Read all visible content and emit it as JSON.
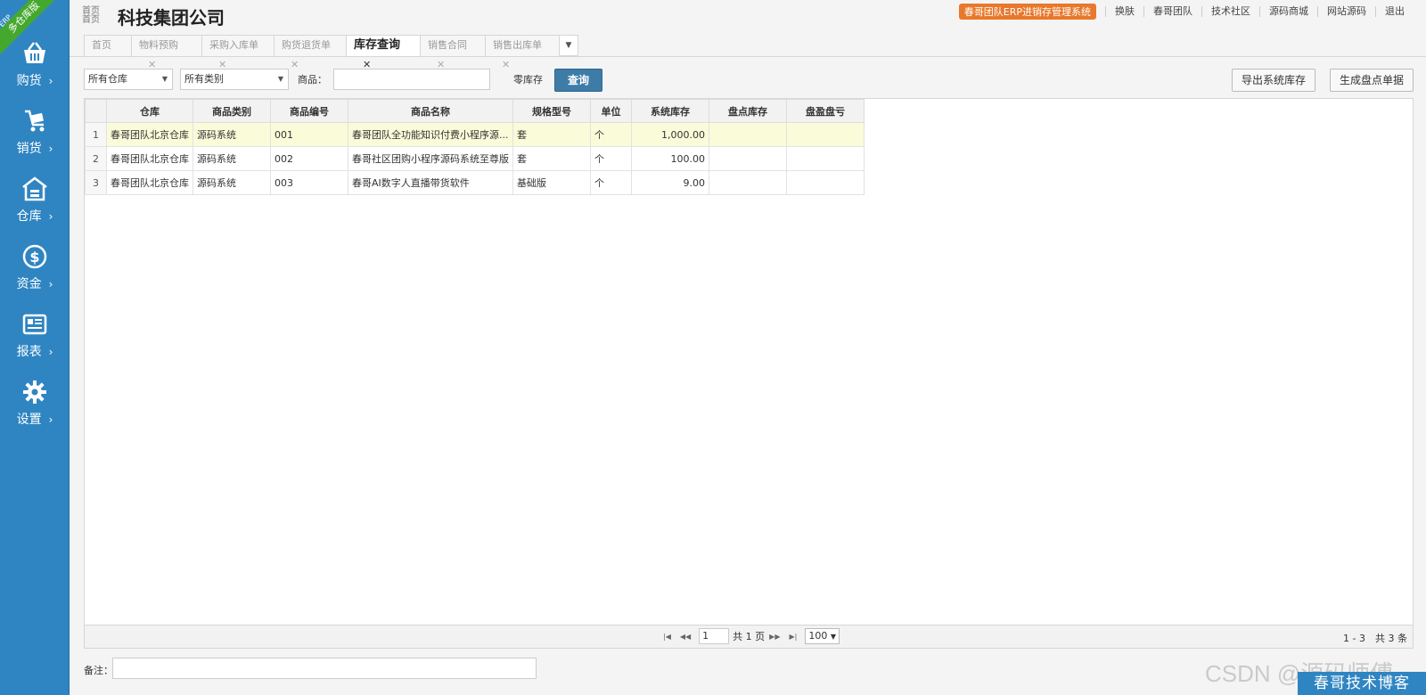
{
  "sidebar": {
    "ribbon_top": "ERP",
    "ribbon_text": "多仓库版",
    "items": [
      {
        "label": "购货",
        "icon": "basket-icon"
      },
      {
        "label": "销货",
        "icon": "cart-icon"
      },
      {
        "label": "仓库",
        "icon": "warehouse-icon"
      },
      {
        "label": "资金",
        "icon": "dollar-icon"
      },
      {
        "label": "报表",
        "icon": "report-icon"
      },
      {
        "label": "设置",
        "icon": "gear-icon"
      }
    ],
    "arrow": "›"
  },
  "header": {
    "brand_small_line1": "首页",
    "brand_small_line2": "首页",
    "title": "科技集团公司",
    "promo": "春哥团队ERP进销存管理系统",
    "links": [
      "换肤",
      "春哥团队",
      "技术社区",
      "源码商城",
      "网站源码",
      "退出"
    ]
  },
  "tabs": [
    {
      "label": "首页",
      "closable": false
    },
    {
      "label": "物料预购",
      "closable": true
    },
    {
      "label": "采购入库单",
      "closable": true
    },
    {
      "label": "购货退货单",
      "closable": true
    },
    {
      "label": "库存查询",
      "closable": true,
      "active": true
    },
    {
      "label": "销售合同",
      "closable": true
    },
    {
      "label": "销售出库单",
      "closable": true
    }
  ],
  "filters": {
    "warehouse": "所有仓库",
    "category": "所有类别",
    "product_label": "商品：",
    "product_value": "",
    "zero_stock": "零库存",
    "query_button": "查询",
    "export_button": "导出系统库存",
    "generate_button": "生成盘点单据"
  },
  "grid": {
    "columns": [
      "仓库",
      "商品类别",
      "商品编号",
      "商品名称",
      "规格型号",
      "单位",
      "系统库存",
      "盘点库存",
      "盘盈盘亏"
    ],
    "rows": [
      {
        "no": "1",
        "warehouse": "春哥团队北京仓库",
        "category": "源码系统",
        "code": "001",
        "name": "春哥团队全功能知识付费小程序源...",
        "spec": "套",
        "unit": "个",
        "stock": "1,000.00",
        "check": "",
        "diff": ""
      },
      {
        "no": "2",
        "warehouse": "春哥团队北京仓库",
        "category": "源码系统",
        "code": "002",
        "name": "春哥社区团购小程序源码系统至尊版",
        "spec": "套",
        "unit": "个",
        "stock": "100.00",
        "check": "",
        "diff": ""
      },
      {
        "no": "3",
        "warehouse": "春哥团队北京仓库",
        "category": "源码系统",
        "code": "003",
        "name": "春哥AI数字人直播带货软件",
        "spec": "基础版",
        "unit": "个",
        "stock": "9.00",
        "check": "",
        "diff": ""
      }
    ]
  },
  "pager": {
    "first": "|◀",
    "prev": "◀◀",
    "page": "1",
    "total_pages": "共 1 页",
    "next": "▶▶",
    "last": "▶|",
    "page_size": "100",
    "summary": "1 - 3　共 3 条"
  },
  "remark": {
    "label": "备注：",
    "value": ""
  },
  "watermark": {
    "csdn": "CSDN @源码师傅",
    "blog": "春哥技术博客"
  },
  "colors": {
    "sidebar": "#2f85c2",
    "ribbon": "#45a82e",
    "promo": "#e8782b",
    "query": "#3e7ca8",
    "selected_row": "#f9fbd9"
  }
}
